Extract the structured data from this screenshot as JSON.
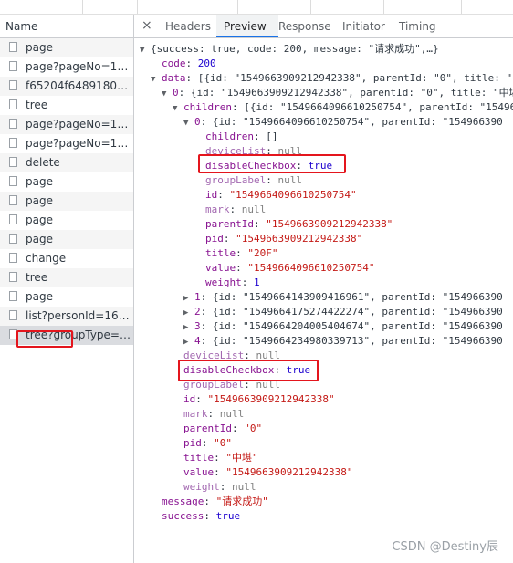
{
  "network": {
    "name_header": "Name",
    "requests": [
      {
        "label": "page"
      },
      {
        "label": "page?pageNo=1&p..."
      },
      {
        "label": "f65204f64891806ca..."
      },
      {
        "label": "tree"
      },
      {
        "label": "page?pageNo=1&p..."
      },
      {
        "label": "page?pageNo=1&p..."
      },
      {
        "label": "delete"
      },
      {
        "label": "page"
      },
      {
        "label": "page"
      },
      {
        "label": "page"
      },
      {
        "label": "page"
      },
      {
        "label": "change"
      },
      {
        "label": "tree"
      },
      {
        "label": "page"
      },
      {
        "label": "list?personId=1637..."
      },
      {
        "label": "tree?groupType=50..."
      }
    ],
    "selected_index": 15
  },
  "tabs": {
    "close": "×",
    "items": [
      {
        "label": "Headers"
      },
      {
        "label": "Preview"
      },
      {
        "label": "Response"
      },
      {
        "label": "Initiator"
      },
      {
        "label": "Timing"
      }
    ],
    "active": "Preview"
  },
  "preview": {
    "summary": "{success: true, code: 200, message: \"请求成功\",…}",
    "code_key": "code",
    "code_val": "200",
    "data_key": "data",
    "data_summary": "[{id: \"1549663909212942338\", parentId: \"0\", title: \"中",
    "item0_idx": "0",
    "item0_summary": "{id: \"1549663909212942338\", parentId: \"0\", title: \"中堪",
    "children_key": "children",
    "children_summary": "[{id: \"1549664096610250754\", parentId: \"15496",
    "c0_idx": "0",
    "c0_summary": "{id: \"1549664096610250754\", parentId: \"154966390",
    "c0_children_key": "children",
    "c0_children_val": "[]",
    "c0_devicelist_key": "deviceList",
    "c0_devicelist_val": "null",
    "c0_disable_key": "disableCheckbox",
    "c0_disable_val": "true",
    "c0_grouplabel_key": "groupLabel",
    "c0_grouplabel_val": "null",
    "c0_id_key": "id",
    "c0_id_val": "\"1549664096610250754\"",
    "c0_mark_key": "mark",
    "c0_mark_val": "null",
    "c0_parent_key": "parentId",
    "c0_parent_val": "\"1549663909212942338\"",
    "c0_pid_key": "pid",
    "c0_pid_val": "\"1549663909212942338\"",
    "c0_title_key": "title",
    "c0_title_val": "\"20F\"",
    "c0_value_key": "value",
    "c0_value_val": "\"1549664096610250754\"",
    "c0_weight_key": "weight",
    "c0_weight_val": "1",
    "c1_idx": "1",
    "c1_summary": "{id: \"1549664143909416961\", parentId: \"154966390",
    "c2_idx": "2",
    "c2_summary": "{id: \"1549664175274422274\", parentId: \"154966390",
    "c3_idx": "3",
    "c3_summary": "{id: \"1549664204005404674\", parentId: \"154966390",
    "c4_idx": "4",
    "c4_summary": "{id: \"1549664234980339713\", parentId: \"154966390",
    "i0_devicelist_key": "deviceList",
    "i0_devicelist_val": "null",
    "i0_disable_key": "disableCheckbox",
    "i0_disable_val": "true",
    "i0_grouplabel_key": "groupLabel",
    "i0_grouplabel_val": "null",
    "i0_id_key": "id",
    "i0_id_val": "\"1549663909212942338\"",
    "i0_mark_key": "mark",
    "i0_mark_val": "null",
    "i0_parent_key": "parentId",
    "i0_parent_val": "\"0\"",
    "i0_pid_key": "pid",
    "i0_pid_val": "\"0\"",
    "i0_title_key": "title",
    "i0_title_val": "\"中堪\"",
    "i0_value_key": "value",
    "i0_value_val": "\"1549663909212942338\"",
    "i0_weight_key": "weight",
    "i0_weight_val": "null",
    "message_key": "message",
    "message_val": "\"请求成功\"",
    "success_key": "success",
    "success_val": "true"
  },
  "watermark": "CSDN @Destiny辰",
  "colors": {
    "highlight_box": "#e4151d",
    "active_tab_underline": "#1a73e8"
  }
}
